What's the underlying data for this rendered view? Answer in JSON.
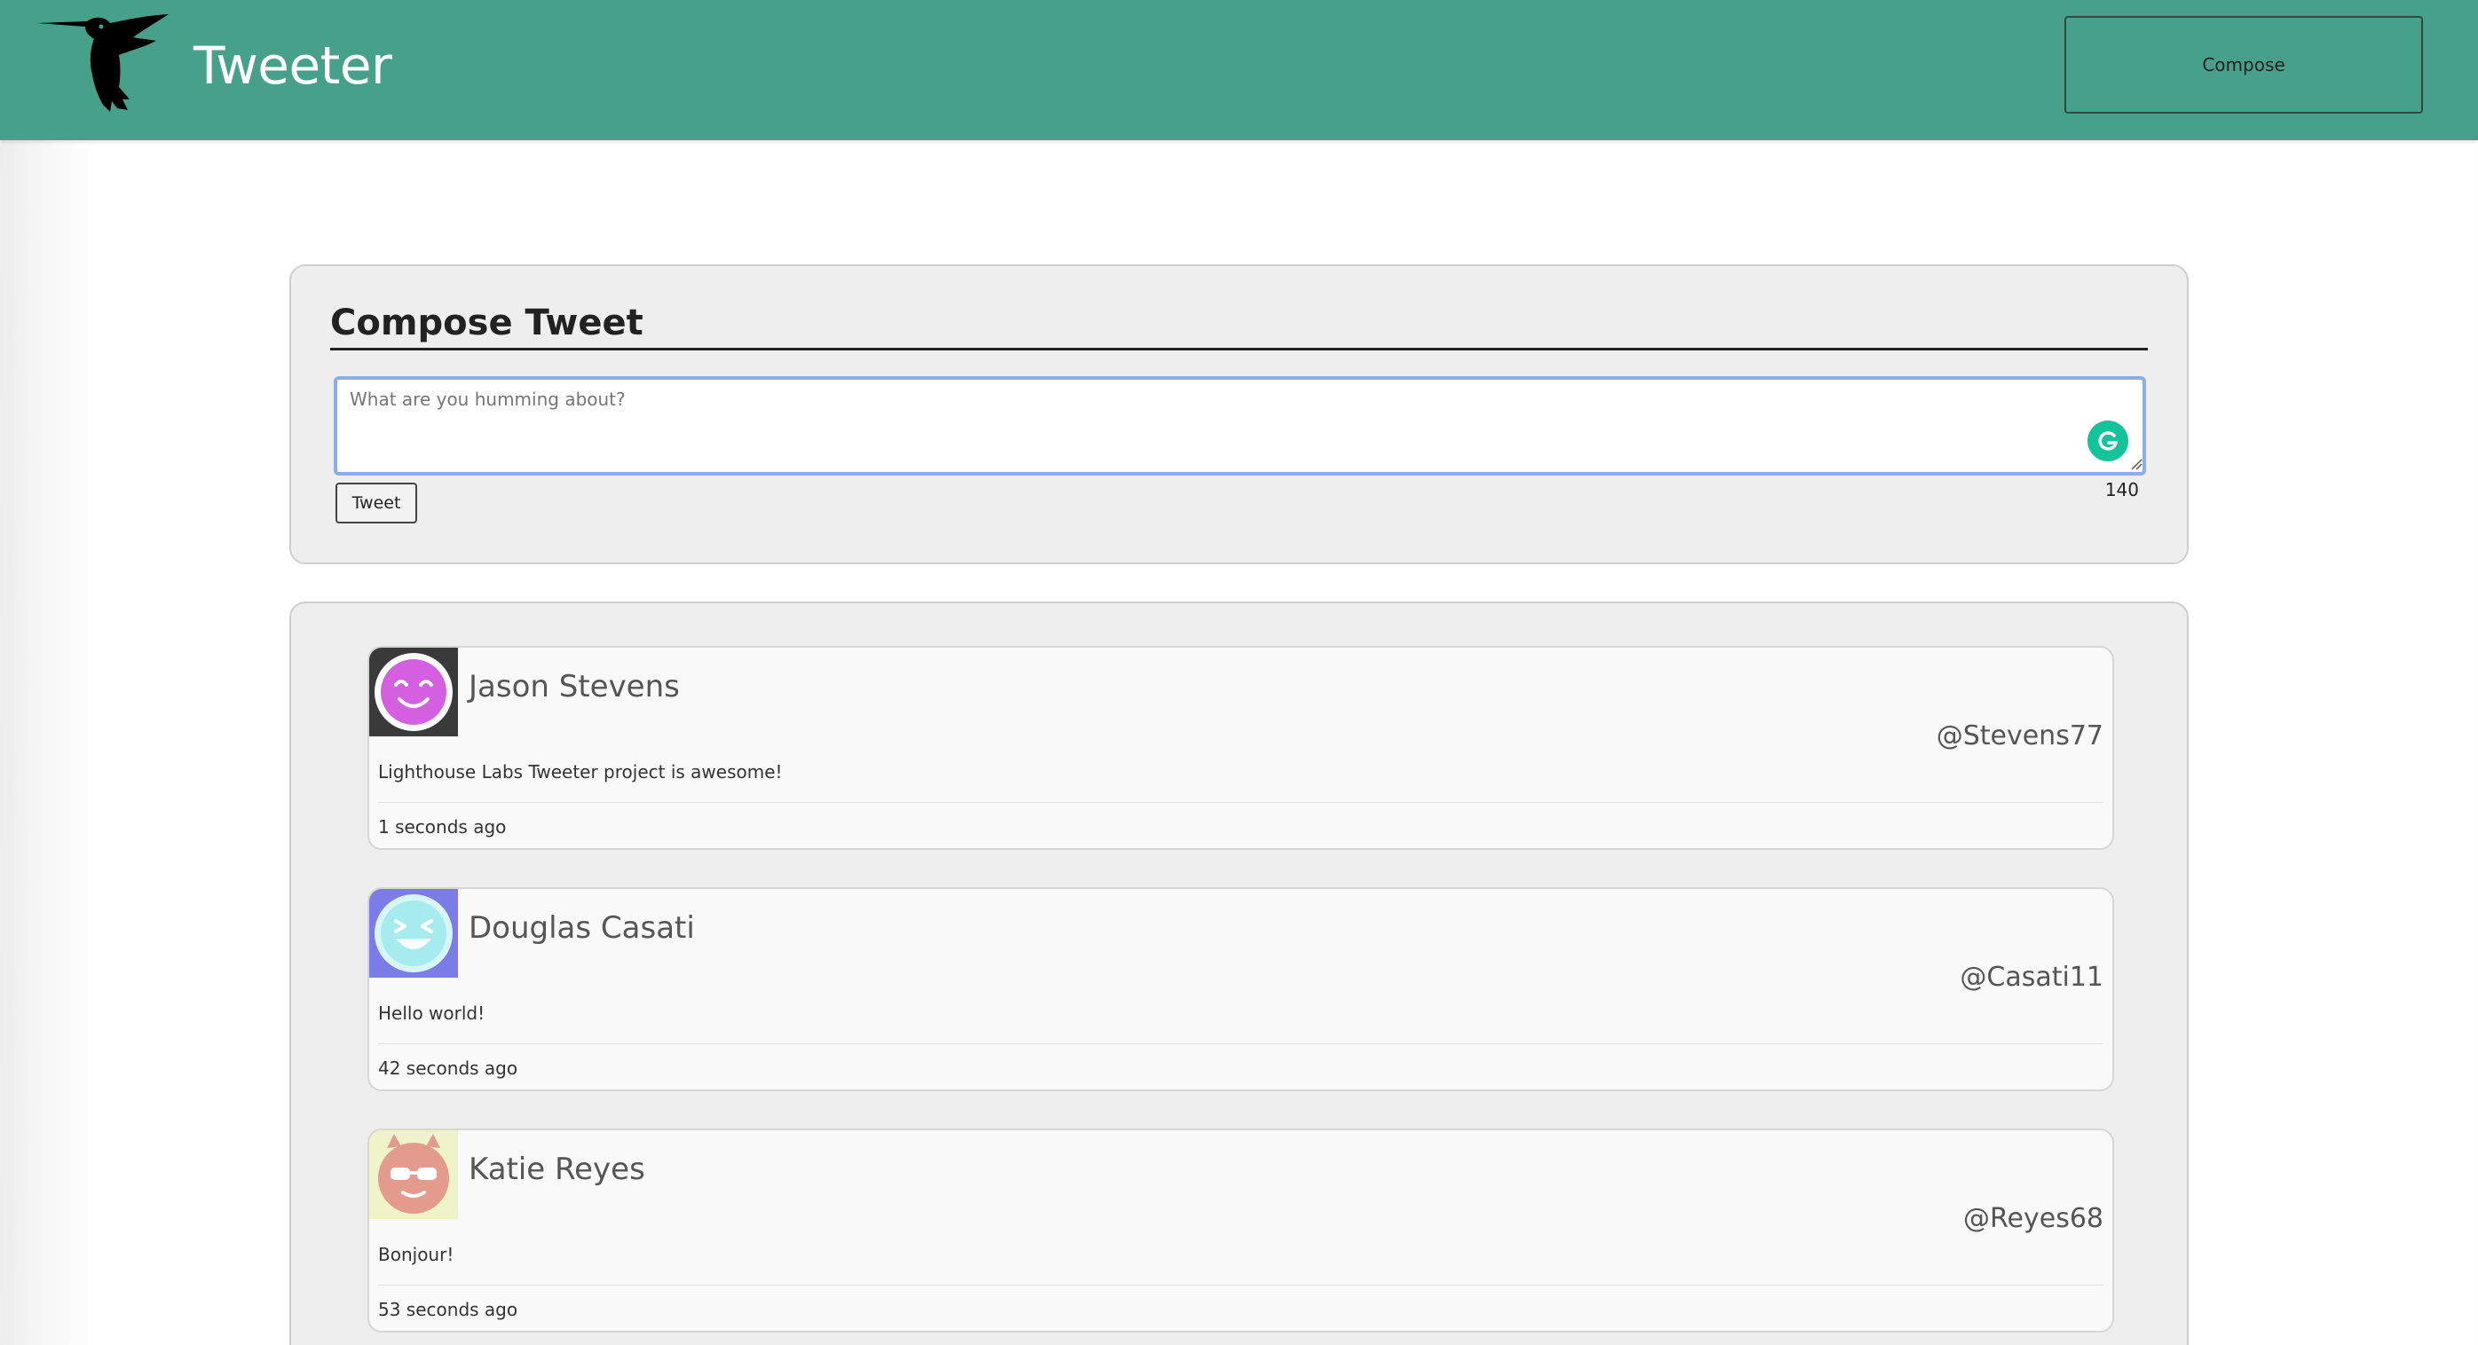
{
  "nav": {
    "logo_icon": "hummingbird-icon",
    "brand": "Tweeter",
    "compose_label": "Compose",
    "bg_color": "#47a08a"
  },
  "compose": {
    "title": "Compose Tweet",
    "placeholder": "What are you humming about?",
    "tweet_label": "Tweet",
    "counter": "140",
    "extension_icon": "grammarly-icon"
  },
  "tweets": [
    {
      "name": "Jason Stevens",
      "handle": "@Stevens77",
      "text": "Lighthouse Labs Tweeter project is awesome!",
      "time": "1 seconds ago",
      "avatar_icon": "smiling-face-avatar-icon",
      "avatar_bg": "#3a3a3a",
      "avatar_fg": "#d45fe0"
    },
    {
      "name": "Douglas Casati",
      "handle": "@Casati11",
      "text": "Hello world!",
      "time": "42 seconds ago",
      "avatar_icon": "laughing-face-avatar-icon",
      "avatar_bg": "#7b7ce8",
      "avatar_fg": "#a6ecef"
    },
    {
      "name": "Katie Reyes",
      "handle": "@Reyes68",
      "text": "Bonjour!",
      "time": "53 seconds ago",
      "avatar_icon": "sunglasses-devil-face-avatar-icon",
      "avatar_bg": "#eef3c8",
      "avatar_fg": "#e39b8e"
    }
  ]
}
